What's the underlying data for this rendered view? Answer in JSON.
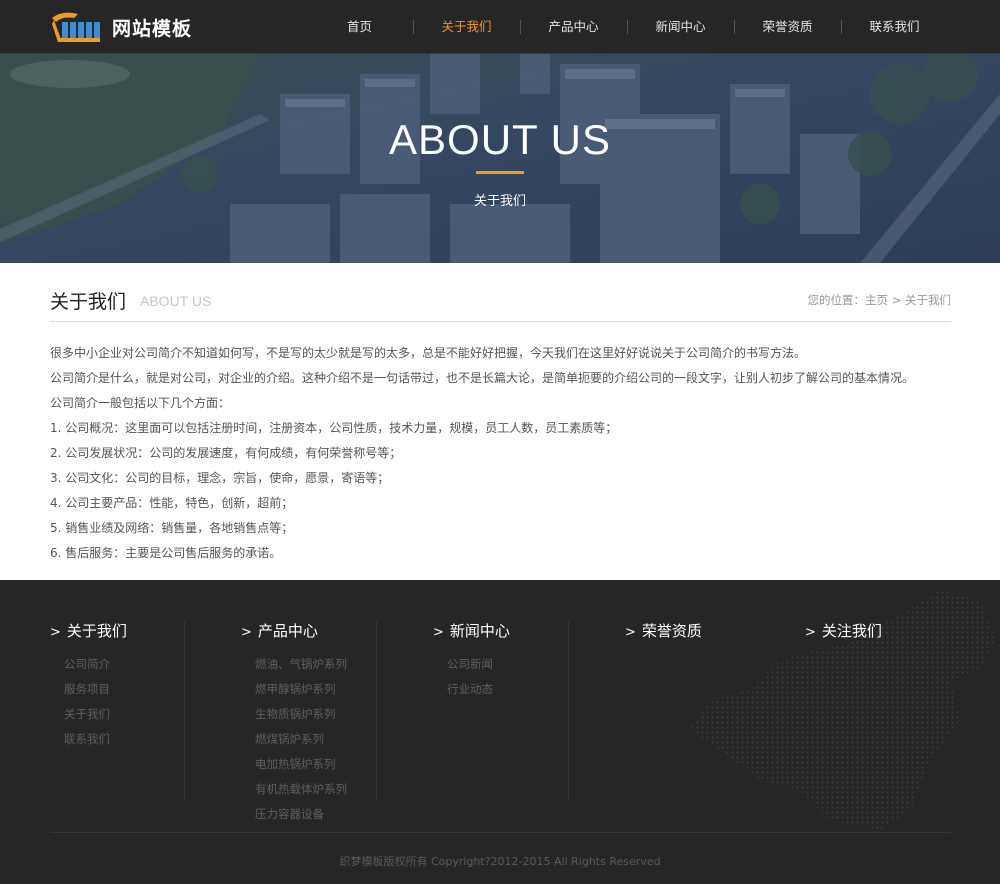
{
  "header": {
    "logo_text": "网站模板",
    "nav": [
      {
        "label": "首页",
        "active": false
      },
      {
        "label": "关于我们",
        "active": true
      },
      {
        "label": "产品中心",
        "active": false
      },
      {
        "label": "新闻中心",
        "active": false
      },
      {
        "label": "荣誉资质",
        "active": false
      },
      {
        "label": "联系我们",
        "active": false
      }
    ]
  },
  "banner": {
    "title": "ABOUT US",
    "subtitle": "关于我们"
  },
  "content": {
    "title": "关于我们",
    "subtitle": "ABOUT US",
    "breadcrumb": {
      "prefix": "您的位置：",
      "home": "主页",
      "sep": ">",
      "current": "关于我们"
    },
    "paragraphs": [
      "很多中小企业对公司简介不知道如何写，不是写的太少就是写的太多，总是不能好好把握，今天我们在这里好好说说关于公司简介的书写方法。",
      "公司简介是什么，就是对公司，对企业的介绍。这种介绍不是一句话带过，也不是长篇大论，是简单扼要的介绍公司的一段文字，让别人初步了解公司的基本情况。",
      "公司简介一般包括以下几个方面：",
      "1. 公司概况：这里面可以包括注册时间，注册资本，公司性质，技术力量，规模，员工人数，员工素质等；",
      "2. 公司发展状况：公司的发展速度，有何成绩，有何荣誉称号等；",
      "3. 公司文化：公司的目标，理念，宗旨，使命，愿景，寄语等；",
      "4. 公司主要产品：性能，特色，创新，超前；",
      "5. 销售业绩及网络：销售量，各地销售点等；",
      "6. 售后服务：主要是公司售后服务的承诺。"
    ]
  },
  "footer": {
    "columns": [
      {
        "title": "关于我们",
        "links": [
          "公司简介",
          "服务项目",
          "关于我们",
          "联系我们"
        ]
      },
      {
        "title": "产品中心",
        "links": [
          "燃油、气锅炉系列",
          "燃甲醇锅炉系列",
          "生物质锅炉系列",
          "燃煤锅炉系列",
          "电加热锅炉系列",
          "有机热载体炉系列",
          "压力容器设备"
        ]
      },
      {
        "title": "新闻中心",
        "links": [
          "公司新闻",
          "行业动态"
        ]
      },
      {
        "title": "荣誉资质",
        "links": []
      },
      {
        "title": "关注我们",
        "links": []
      }
    ],
    "chevron": ">",
    "copyright": "织梦模板版权所有 Copyright?2012-2015 All Rights Reserved"
  },
  "colors": {
    "accent": "#f39a1f",
    "header_bg": "#262626",
    "footer_bg": "#262626",
    "banner_tint": "#34455f"
  }
}
